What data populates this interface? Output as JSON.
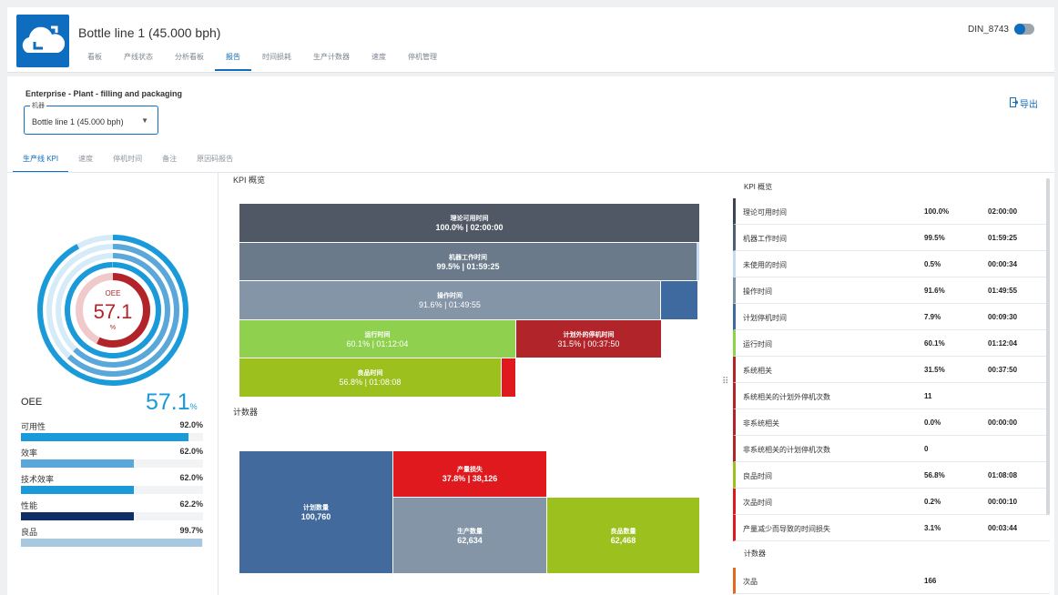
{
  "header": {
    "title": "Bottle line 1 (45.000 bph)",
    "user": "DIN_8743",
    "tabs": [
      "看板",
      "产线状态",
      "分析看板",
      "报告",
      "时间损耗",
      "生产计数器",
      "速度",
      "停机管理"
    ],
    "active_tab": "报告"
  },
  "toolbar": {
    "breadcrumb": "Enterprise - Plant - filling and packaging",
    "machine_label": "机器",
    "machine_value": "Bottle line 1 (45.000 bph)",
    "export_label": "导出"
  },
  "sub_tabs": [
    "生产线 KPI",
    "速度",
    "停机时间",
    "备注",
    "原因码报告"
  ],
  "active_sub_tab": "生产线 KPI",
  "oee": {
    "gauge_label": "OEE",
    "value": "57.1",
    "unit": "%",
    "label": "OEE",
    "big_value": "57.1",
    "big_unit": "%",
    "metrics": [
      {
        "name": "可用性",
        "value": "92.0%",
        "fraction": 0.92,
        "color": "#1a9ad8"
      },
      {
        "name": "效率",
        "value": "62.0%",
        "fraction": 0.62,
        "color": "#5aa7d9"
      },
      {
        "name": "技术效率",
        "value": "62.0%",
        "fraction": 0.62,
        "color": "#1a9ad8"
      },
      {
        "name": "性能",
        "value": "62.2%",
        "fraction": 0.622,
        "color": "#0f2f66"
      },
      {
        "name": "良品",
        "value": "99.7%",
        "fraction": 0.997,
        "color": "#a8c8e0"
      }
    ]
  },
  "kpi_overview": {
    "title": "KPI 概览",
    "blocks": [
      {
        "label": "理论可用时间",
        "value": "100.0% | 02:00:00"
      },
      {
        "label": "机器工作时间",
        "value": "99.5% | 01:59:25"
      },
      {
        "label": "操作时间",
        "value": "91.6% | 01:49:55"
      },
      {
        "label": "运行时间",
        "value": "60.1% | 01:12:04"
      },
      {
        "label": "计划外的停机时间",
        "value": "31.5% | 00:37:50"
      },
      {
        "label": "良品时间",
        "value": "56.8% | 01:08:08"
      }
    ]
  },
  "counter": {
    "title": "计数器",
    "blocks": [
      {
        "label": "计划数量",
        "value": "100,760"
      },
      {
        "label": "产量损失",
        "value": "37.8% | 38,126"
      },
      {
        "label": "生产数量",
        "value": "62,634"
      },
      {
        "label": "良品数量",
        "value": "62,468"
      }
    ]
  },
  "table": {
    "kpi_header": "KPI 概览",
    "counter_header": "计数器",
    "rows": [
      {
        "name": "理论可用时间",
        "pct": "100.0%",
        "time": "02:00:00",
        "color": "#3b4450"
      },
      {
        "name": "机器工作时间",
        "pct": "99.5%",
        "time": "01:59:25",
        "color": "#4e5f72"
      },
      {
        "name": "未使用的时间",
        "pct": "0.5%",
        "time": "00:00:34",
        "color": "#c7dcf2"
      },
      {
        "name": "操作时间",
        "pct": "91.6%",
        "time": "01:49:55",
        "color": "#7f92a6"
      },
      {
        "name": "计划停机时间",
        "pct": "7.9%",
        "time": "00:09:30",
        "color": "#3f6aa0"
      },
      {
        "name": "运行时间",
        "pct": "60.1%",
        "time": "01:12:04",
        "color": "#8fd14f"
      },
      {
        "name": "系统相关",
        "pct": "31.5%",
        "time": "00:37:50",
        "color": "#b0242a"
      },
      {
        "name": "系统相关的计划外停机次数",
        "pct": "11",
        "time": "",
        "color": "#b0242a"
      },
      {
        "name": "非系统相关",
        "pct": "0.0%",
        "time": "00:00:00",
        "color": "#b0242a"
      },
      {
        "name": "非系统相关的计划停机次数",
        "pct": "0",
        "time": "",
        "color": "#b0242a"
      },
      {
        "name": "良品时间",
        "pct": "56.8%",
        "time": "01:08:08",
        "color": "#9cc01e"
      },
      {
        "name": "次品时间",
        "pct": "0.2%",
        "time": "00:00:10",
        "color": "#e0191e"
      },
      {
        "name": "产量减少而导致的时间损失",
        "pct": "3.1%",
        "time": "00:03:44",
        "color": "#e0191e"
      }
    ],
    "counter_rows": [
      {
        "name": "次品",
        "pct": "166",
        "time": "",
        "color": "#e06a1e"
      }
    ]
  }
}
